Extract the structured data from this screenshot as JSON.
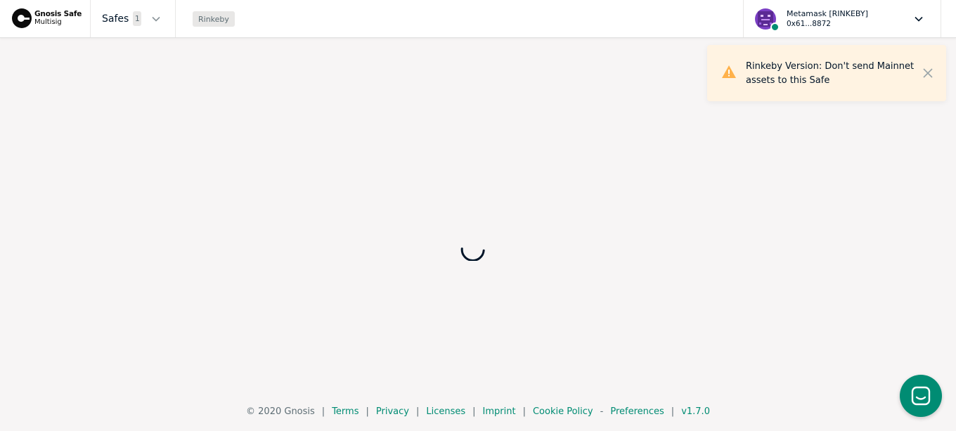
{
  "header": {
    "logo_title": "Gnosis Safe",
    "logo_subtitle": "Multisig",
    "safes_label": "Safes",
    "safes_count": "1",
    "network": "Rinkeby",
    "account": {
      "name": "Metamask [RINKEBY]",
      "address": "0x61...8872",
      "status_color": "#008c73"
    }
  },
  "notification": {
    "message": "Rinkeby Version: Don't send Mainnet assets to this Safe",
    "icon": "warning-icon",
    "background": "#fff3e2"
  },
  "main": {
    "state": "loading",
    "spinner_color": "#001428"
  },
  "footer": {
    "copyright": "© 2020 Gnosis",
    "links": [
      "Terms",
      "Privacy",
      "Licenses",
      "Imprint",
      "Cookie Policy",
      "Preferences",
      "v1.7.0"
    ],
    "separator": "|",
    "dash": "-"
  },
  "chat": {
    "icon": "chat-icon",
    "color": "#008c73"
  },
  "colors": {
    "accent": "#008c73",
    "text_dark": "#001428",
    "text_muted": "#5d6d74",
    "page_bg": "#f7f5f5"
  }
}
